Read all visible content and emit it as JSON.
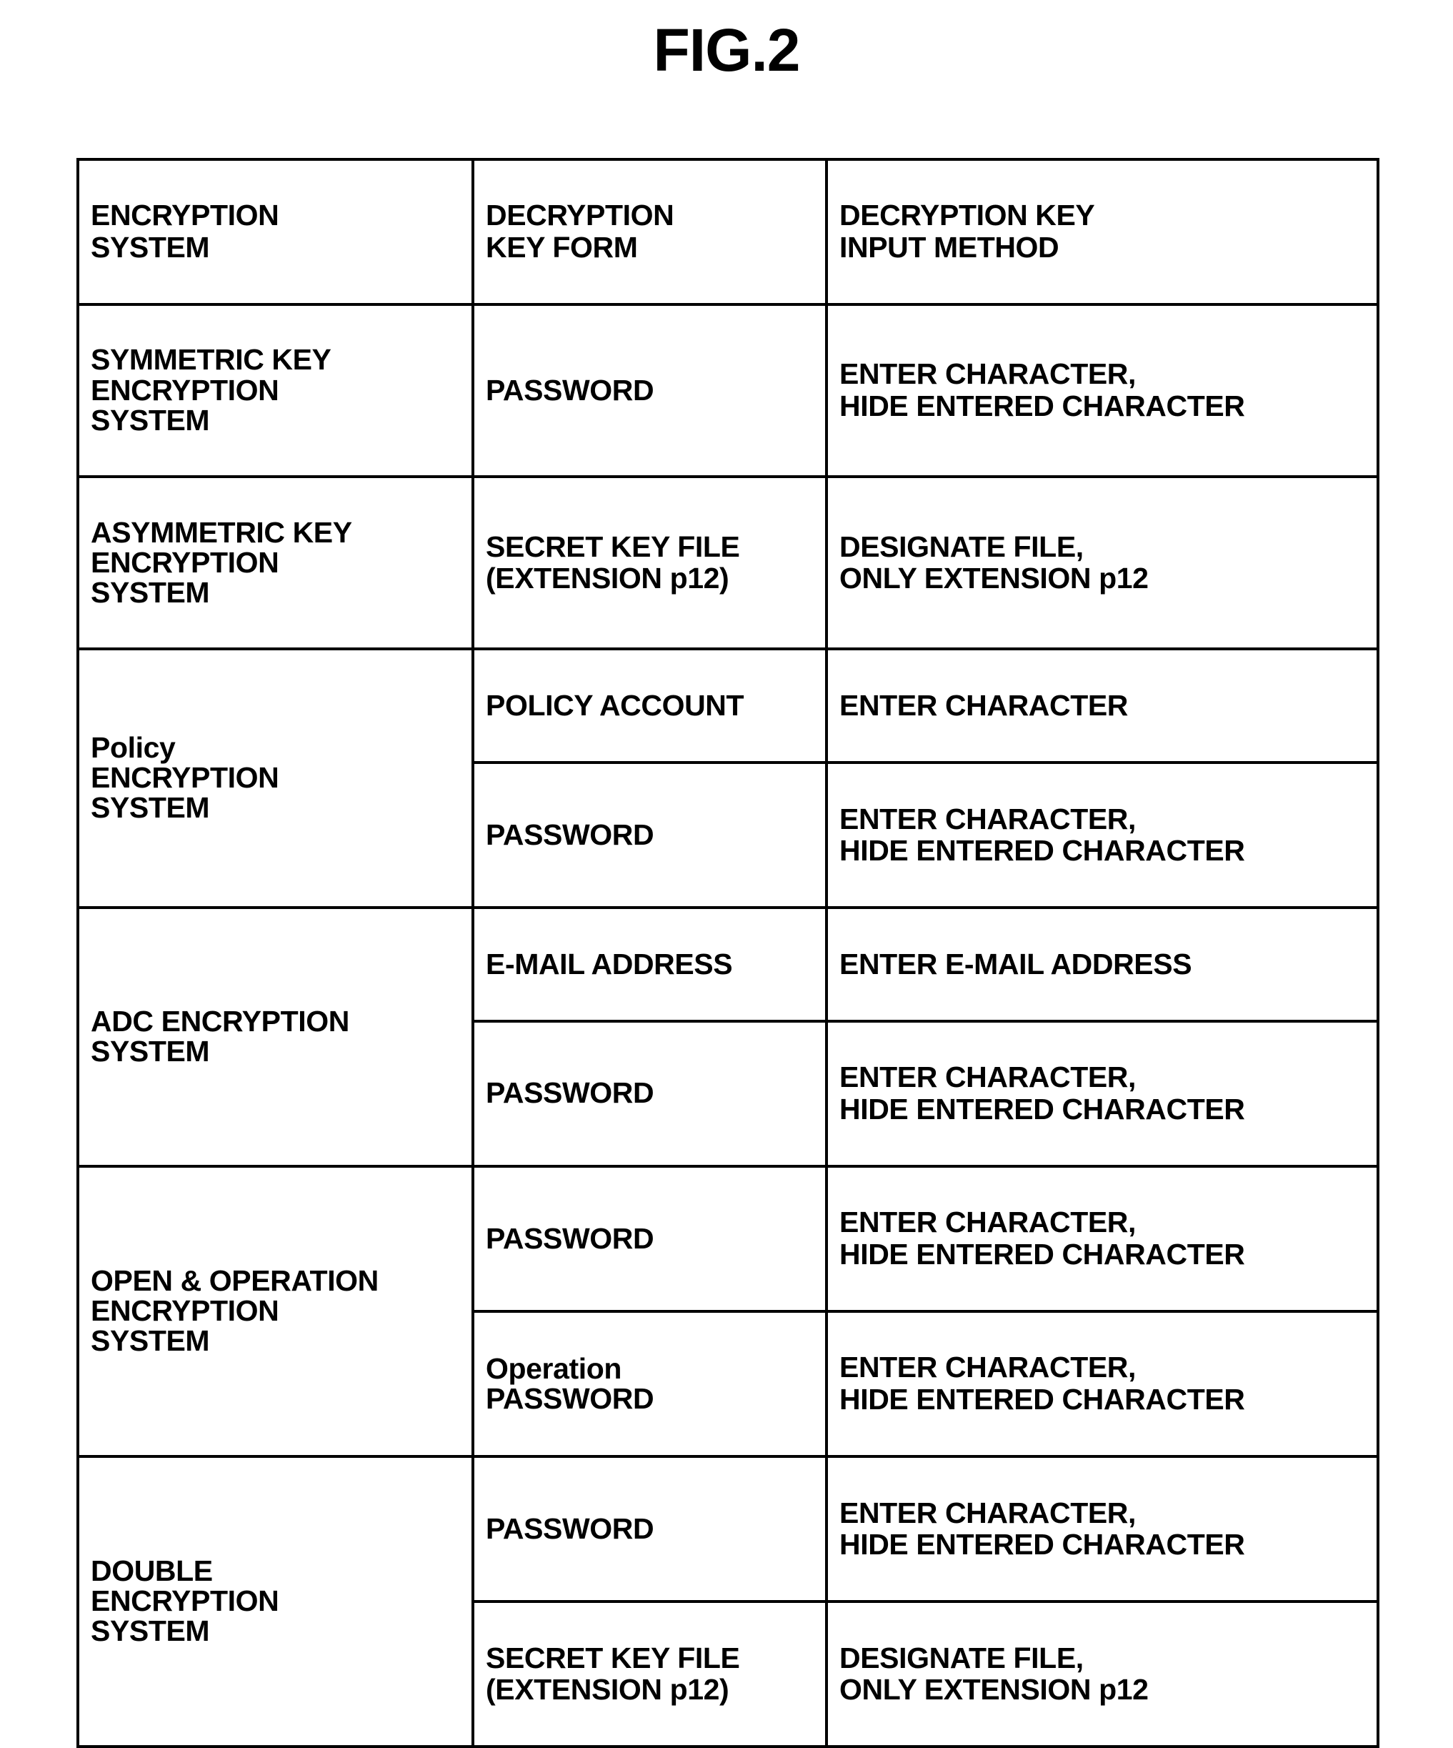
{
  "figure": {
    "title": "FIG.2"
  },
  "table": {
    "headers": {
      "col1": "ENCRYPTION\nSYSTEM",
      "col2": "DECRYPTION\nKEY FORM",
      "col3": "DECRYPTION KEY\nINPUT METHOD"
    },
    "rows": [
      {
        "system": "SYMMETRIC KEY\nENCRYPTION\nSYSTEM",
        "entries": [
          {
            "key_form": "PASSWORD",
            "input_method": "ENTER CHARACTER,\nHIDE ENTERED CHARACTER"
          }
        ]
      },
      {
        "system": "ASYMMETRIC KEY\nENCRYPTION\nSYSTEM",
        "entries": [
          {
            "key_form": "SECRET KEY FILE\n(EXTENSION p12)",
            "input_method": "DESIGNATE FILE,\nONLY EXTENSION p12"
          }
        ]
      },
      {
        "system": "Policy\nENCRYPTION\nSYSTEM",
        "entries": [
          {
            "key_form": "POLICY ACCOUNT",
            "input_method": "ENTER CHARACTER"
          },
          {
            "key_form": "PASSWORD",
            "input_method": "ENTER CHARACTER,\nHIDE ENTERED CHARACTER"
          }
        ]
      },
      {
        "system": "ADC ENCRYPTION\nSYSTEM",
        "entries": [
          {
            "key_form": "E-MAIL ADDRESS",
            "input_method": "ENTER E-MAIL ADDRESS"
          },
          {
            "key_form": "PASSWORD",
            "input_method": "ENTER CHARACTER,\nHIDE ENTERED CHARACTER"
          }
        ]
      },
      {
        "system": "OPEN & OPERATION\nENCRYPTION\nSYSTEM",
        "entries": [
          {
            "key_form": "PASSWORD",
            "input_method": "ENTER CHARACTER,\nHIDE ENTERED CHARACTER"
          },
          {
            "key_form": "Operation\nPASSWORD",
            "input_method": "ENTER CHARACTER,\nHIDE ENTERED CHARACTER"
          }
        ]
      },
      {
        "system": "DOUBLE\nENCRYPTION\nSYSTEM",
        "entries": [
          {
            "key_form": "PASSWORD",
            "input_method": "ENTER CHARACTER,\nHIDE ENTERED CHARACTER"
          },
          {
            "key_form": "SECRET KEY FILE\n(EXTENSION p12)",
            "input_method": "DESIGNATE FILE,\nONLY EXTENSION p12"
          }
        ]
      }
    ]
  },
  "colors": {
    "ink": "#000000",
    "paper": "#ffffff"
  }
}
